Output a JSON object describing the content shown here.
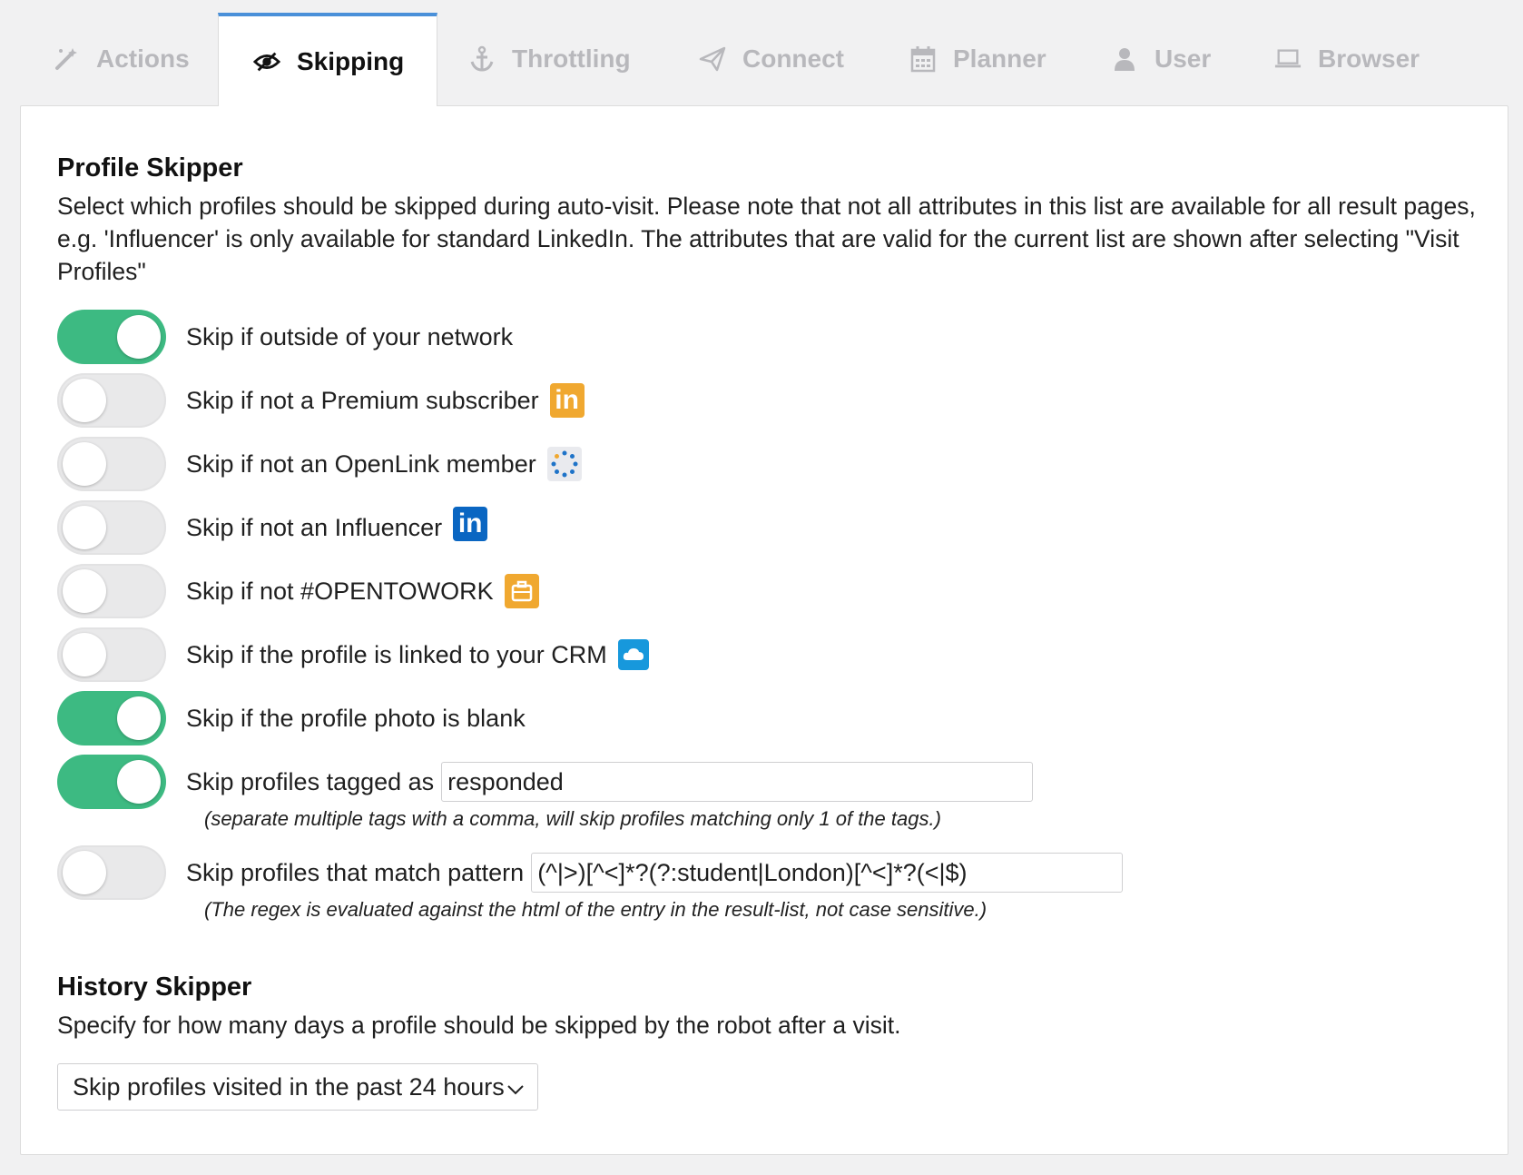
{
  "tabs": [
    {
      "label": "Actions",
      "icon": "magic-wand-icon"
    },
    {
      "label": "Skipping",
      "icon": "eye-slash-icon"
    },
    {
      "label": "Throttling",
      "icon": "anchor-icon"
    },
    {
      "label": "Connect",
      "icon": "paper-plane-icon"
    },
    {
      "label": "Planner",
      "icon": "calendar-icon"
    },
    {
      "label": "User",
      "icon": "user-icon"
    },
    {
      "label": "Browser",
      "icon": "laptop-icon"
    }
  ],
  "active_tab": "Skipping",
  "profile_skipper": {
    "title": "Profile Skipper",
    "description": "Select which profiles should be skipped during auto-visit. Please note that not all attributes in this list are available for all result pages, e.g. 'Influencer' is only available for standard LinkedIn. The attributes that are valid for the current list are shown after selecting \"Visit Profiles\"",
    "options": [
      {
        "label": "Skip if outside of your network",
        "on": true
      },
      {
        "label": "Skip if not a Premium subscriber",
        "on": false,
        "badge": "premium-linkedin-icon",
        "badge_text": "in",
        "badge_color": "#f0a830"
      },
      {
        "label": "Skip if not an OpenLink member",
        "on": false,
        "badge": "openlink-icon"
      },
      {
        "label": "Skip if not an Influencer",
        "on": false,
        "badge": "linkedin-influencer-icon",
        "badge_text": "in",
        "badge_color": "#0a66c2"
      },
      {
        "label": "Skip if not #OPENTOWORK",
        "on": false,
        "badge": "opentowork-icon",
        "badge_color": "#f0a830"
      },
      {
        "label": "Skip if the profile is linked to your CRM",
        "on": false,
        "badge": "crm-cloud-icon",
        "badge_color": "#1798dc"
      },
      {
        "label": "Skip if the profile photo is blank",
        "on": true
      }
    ],
    "tagged": {
      "label": "Skip profiles tagged as",
      "on": true,
      "value": "responded",
      "hint": "(separate multiple tags with a comma, will skip profiles matching only 1 of the tags.)"
    },
    "pattern": {
      "label": "Skip profiles that match pattern",
      "on": false,
      "value": "(^|>)[^<]*?(?:student|London)[^<]*?(<|$)",
      "hint": "(The regex is evaluated against the html of the entry in the result-list, not case sensitive.)"
    }
  },
  "history_skipper": {
    "title": "History Skipper",
    "description": "Specify for how many days a profile should be skipped by the robot after a visit.",
    "selected": "Skip profiles visited in the past 24 hours"
  },
  "colors": {
    "toggle_on": "#3dba82",
    "tab_active_border": "#4a90d9"
  }
}
